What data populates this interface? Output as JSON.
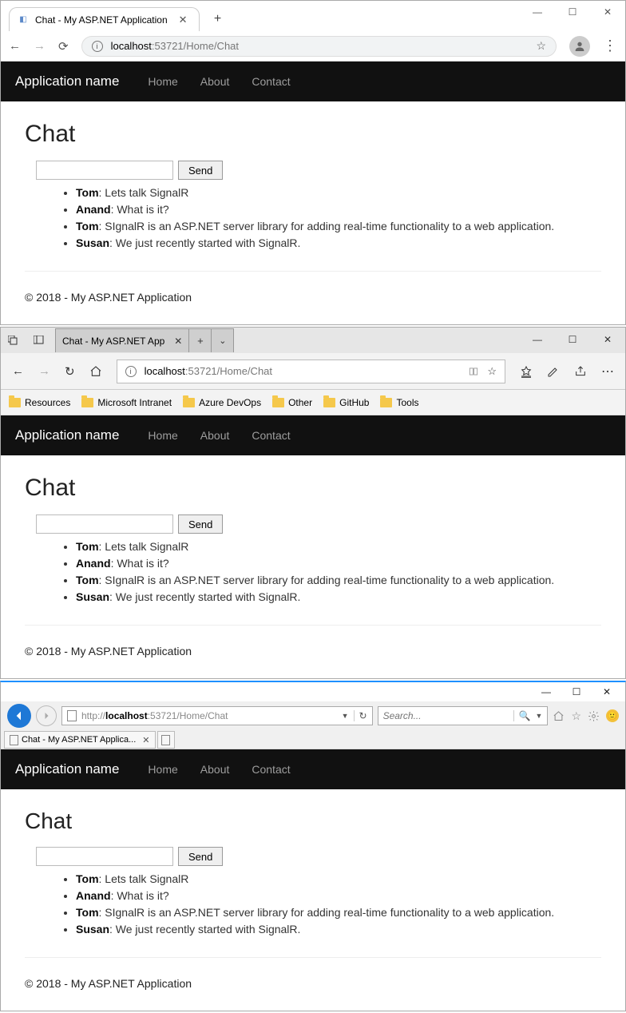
{
  "chrome": {
    "tab_title": "Chat - My ASP.NET Application",
    "url": "localhost:53721/Home/Chat",
    "url_host": "localhost",
    "url_rest": ":53721/Home/Chat"
  },
  "edge": {
    "tab_title": "Chat - My ASP.NET App",
    "url_host": "localhost",
    "url_rest": ":53721/Home/Chat",
    "favorites": [
      "Resources",
      "Microsoft Intranet",
      "Azure DevOps",
      "Other",
      "GitHub",
      "Tools"
    ]
  },
  "ie": {
    "tab_title": "Chat - My ASP.NET Applica...",
    "url_prefix": "http://",
    "url_host": "localhost",
    "url_rest": ":53721/Home/Chat",
    "search_placeholder": "Search..."
  },
  "app": {
    "brand": "Application name",
    "nav": [
      "Home",
      "About",
      "Contact"
    ],
    "page_title": "Chat",
    "send_label": "Send",
    "messages": [
      {
        "user": "Tom",
        "text": "Lets talk SignalR"
      },
      {
        "user": "Anand",
        "text": "What is it?"
      },
      {
        "user": "Tom",
        "text": "SIgnalR is an ASP.NET server library for adding real-time functionality to a web application."
      },
      {
        "user": "Susan",
        "text": "We just recently started with SignalR."
      }
    ],
    "footer": "© 2018 - My ASP.NET Application"
  }
}
